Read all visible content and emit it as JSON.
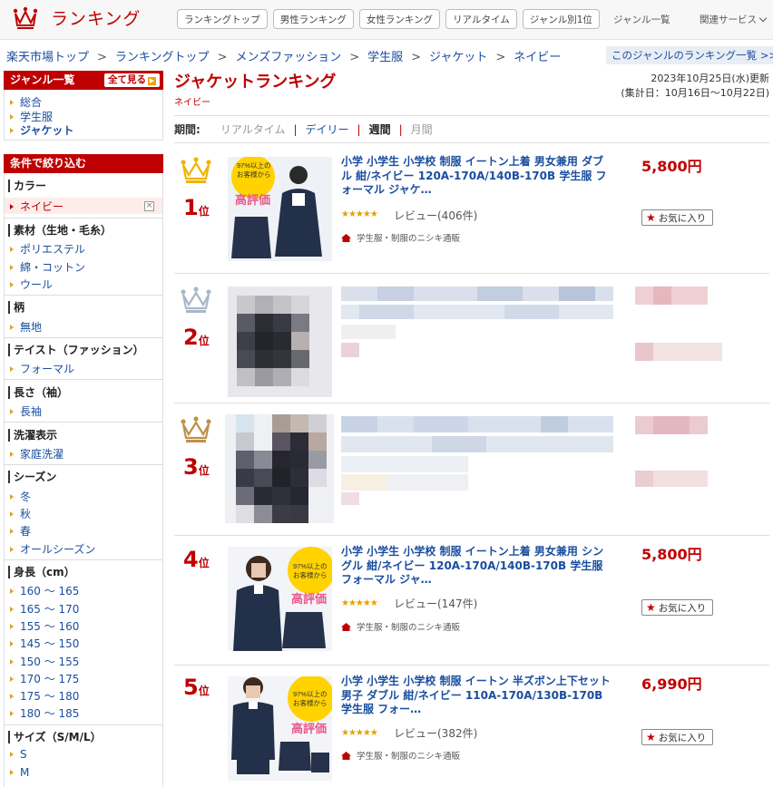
{
  "header": {
    "logo_text": "ランキング",
    "nav": [
      "ランキングトップ",
      "男性ランキング",
      "女性ランキング",
      "リアルタイム",
      "ジャンル別1位"
    ],
    "genre_list": "ジャンル一覧",
    "related": "関連サービス"
  },
  "breadcrumb": [
    "楽天市場トップ",
    "ランキングトップ",
    "メンズファッション",
    "学生服",
    "ジャケット",
    "ネイビー"
  ],
  "genre_ranking_link": "このジャンルのランキング一覧 >>",
  "sidebar": {
    "genre_head": "ジャンル一覧",
    "see_all": "全て見る",
    "genres": [
      "総合",
      "学生服",
      "ジャケット"
    ],
    "filter_head": "条件で絞り込む",
    "sections": [
      {
        "title": "カラー",
        "items": [
          "ネイビー"
        ]
      },
      {
        "title": "素材（生地・毛糸）",
        "items": [
          "ポリエステル",
          "綿・コットン",
          "ウール"
        ]
      },
      {
        "title": "柄",
        "items": [
          "無地"
        ]
      },
      {
        "title": "テイスト（ファッション）",
        "items": [
          "フォーマル"
        ]
      },
      {
        "title": "長さ（袖）",
        "items": [
          "長袖"
        ]
      },
      {
        "title": "洗濯表示",
        "items": [
          "家庭洗濯"
        ]
      },
      {
        "title": "シーズン",
        "items": [
          "冬",
          "秋",
          "春",
          "オールシーズン"
        ]
      },
      {
        "title": "身長（cm）",
        "items": [
          "160 ～ 165",
          "165 ～ 170",
          "155 ～ 160",
          "145 ～ 150",
          "150 ～ 155",
          "170 ～ 175",
          "175 ～ 180",
          "180 ～ 185"
        ]
      },
      {
        "title": "サイズ（S/M/L）",
        "items": [
          "S",
          "M"
        ]
      }
    ]
  },
  "main": {
    "title": "ジャケットランキング",
    "subtitle": "ネイビー",
    "updated": "2023年10月25日(水)更新",
    "period_range": "(集計日：10月16日～10月22日)",
    "period_label": "期間:",
    "period_opts": [
      "リアルタイム",
      "デイリー",
      "週間",
      "月間"
    ]
  },
  "items": [
    {
      "rank": "1",
      "suffix": "位",
      "name": "小学 小学生 小学校 制服 イートン上着 男女兼用 ダブル 紺/ネイビー 120A-170A/140B-170B 学生服 フォーマル ジャケ…",
      "stars": "★★★★★",
      "review": "レビュー(406件)",
      "shop": "学生服・制服のニシキ通販",
      "price": "5,800円",
      "fav": "お気に入り",
      "badge_lines": [
        "97%以上の",
        "お客様から",
        "高評価"
      ],
      "crown": "#f0b400"
    },
    {
      "rank": "2",
      "suffix": "位",
      "crown": "#a8b8c8"
    },
    {
      "rank": "3",
      "suffix": "位",
      "crown": "#c0904a"
    },
    {
      "rank": "4",
      "suffix": "位",
      "name": "小学 小学生 小学校 制服 イートン上着 男女兼用 シングル 紺/ネイビー 120A-170A/140B-170B 学生服 フォーマル ジャ…",
      "stars": "★★★★★",
      "review": "レビュー(147件)",
      "shop": "学生服・制服のニシキ通販",
      "price": "5,800円",
      "fav": "お気に入り",
      "badge_lines": [
        "97%以上の",
        "お客様から",
        "高評価"
      ]
    },
    {
      "rank": "5",
      "suffix": "位",
      "name": "小学 小学生 小学校 制服 イートン 半ズボン上下セット 男子 ダブル 紺/ネイビー 110A-170A/130B-170B 学生服 フォー…",
      "stars": "★★★★★",
      "review": "レビュー(382件)",
      "shop": "学生服・制服のニシキ通販",
      "price": "6,990円",
      "fav": "お気に入り",
      "badge_lines": [
        "97%以上の",
        "お客様から",
        "高評価"
      ]
    }
  ]
}
